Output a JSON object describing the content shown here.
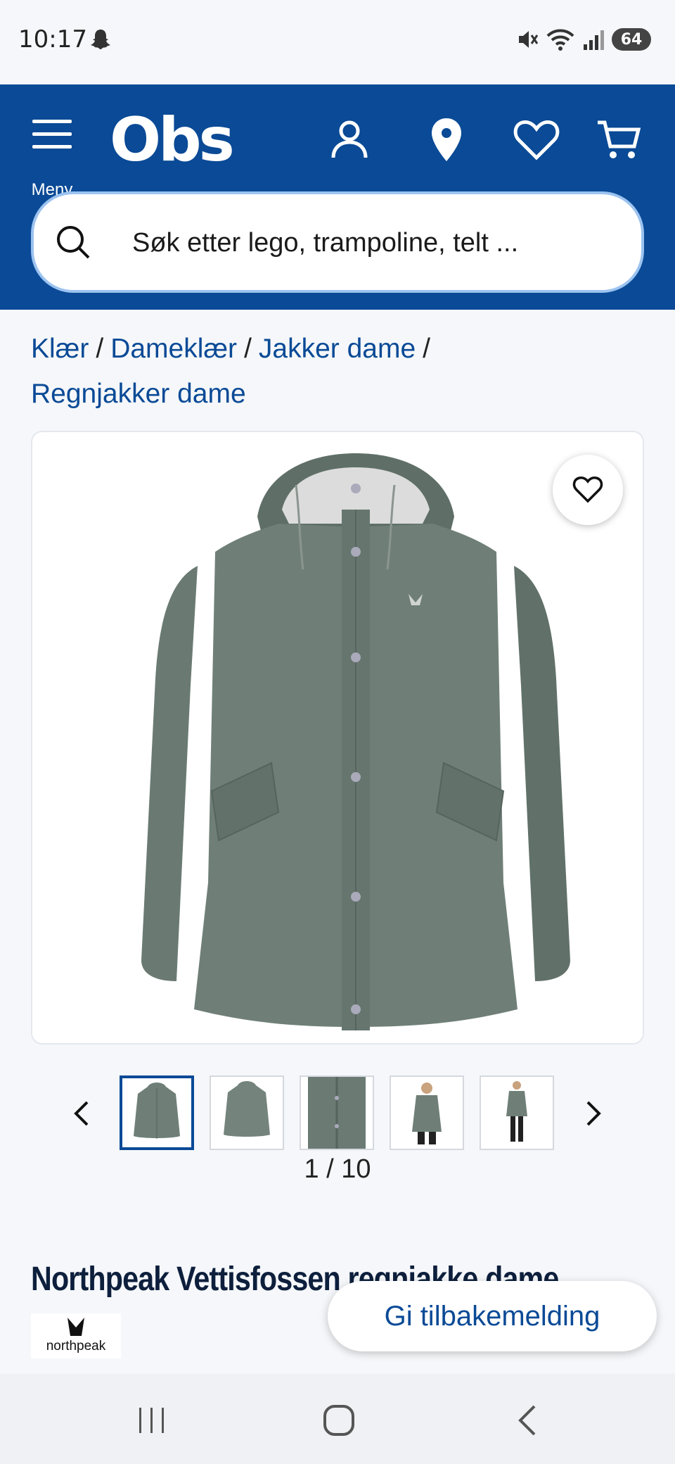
{
  "status_bar": {
    "time": "10:17",
    "battery": "64"
  },
  "header": {
    "menu_label": "Meny",
    "logo": "Obs",
    "search_placeholder": "Søk etter lego, trampoline, telt ..."
  },
  "breadcrumb": {
    "items": [
      "Klær",
      "Dameklær",
      "Jakker dame",
      "Regnjakker dame"
    ],
    "separator": "/"
  },
  "gallery": {
    "counter": "1 / 10",
    "jacket_color": "#6f7f77"
  },
  "product": {
    "title": "Northpeak Vettisfossen regnjakke dame",
    "brand": "northpeak"
  },
  "feedback_button": "Gi tilbakemelding",
  "colors": {
    "brand_blue": "#0a4a96",
    "search_border": "#9cc3f0"
  }
}
